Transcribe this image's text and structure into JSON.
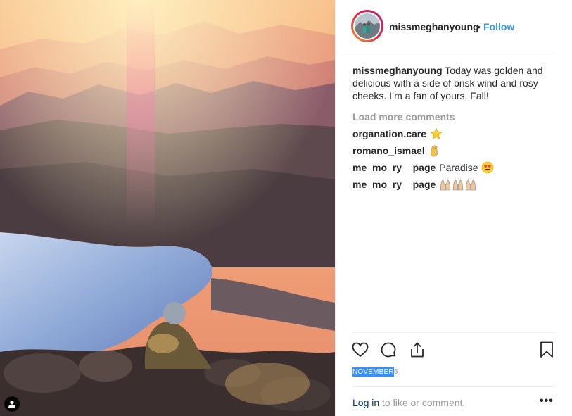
{
  "post": {
    "username": "missmeghanyoung",
    "separator": "•",
    "follow_label": "Follow",
    "caption_user": "missmeghanyoung",
    "caption_text": "Today was golden and delicious with a side of brisk wind and rosy cheeks. I’m a fan of yours, Fall!",
    "load_more_label": "Load more comments",
    "comments": [
      {
        "user": "organation.care",
        "text": "",
        "emoji": "star-emoji"
      },
      {
        "user": "romano_ismael",
        "text": "",
        "emoji": "ok-hand-emoji"
      },
      {
        "user": "me_mo_ry__page",
        "text": "Paradise",
        "emoji": "heart-eyes-emoji"
      },
      {
        "user": "me_mo_ry__page",
        "text": "",
        "emoji": "raising-hands-emoji"
      }
    ],
    "date_selected": "NOVEMBER",
    "date_rest": "5",
    "login_link": "Log in",
    "login_rest": "to like or comment.",
    "more_label": "•••"
  },
  "icons": [
    "heart-icon",
    "comment-icon",
    "share-icon",
    "bookmark-icon",
    "tagged-user-icon",
    "more-options-icon"
  ],
  "colors": {
    "accent": "#3897f0",
    "text": "#262626",
    "muted": "#999999",
    "border": "#efefef",
    "selection": "#3390ff"
  }
}
